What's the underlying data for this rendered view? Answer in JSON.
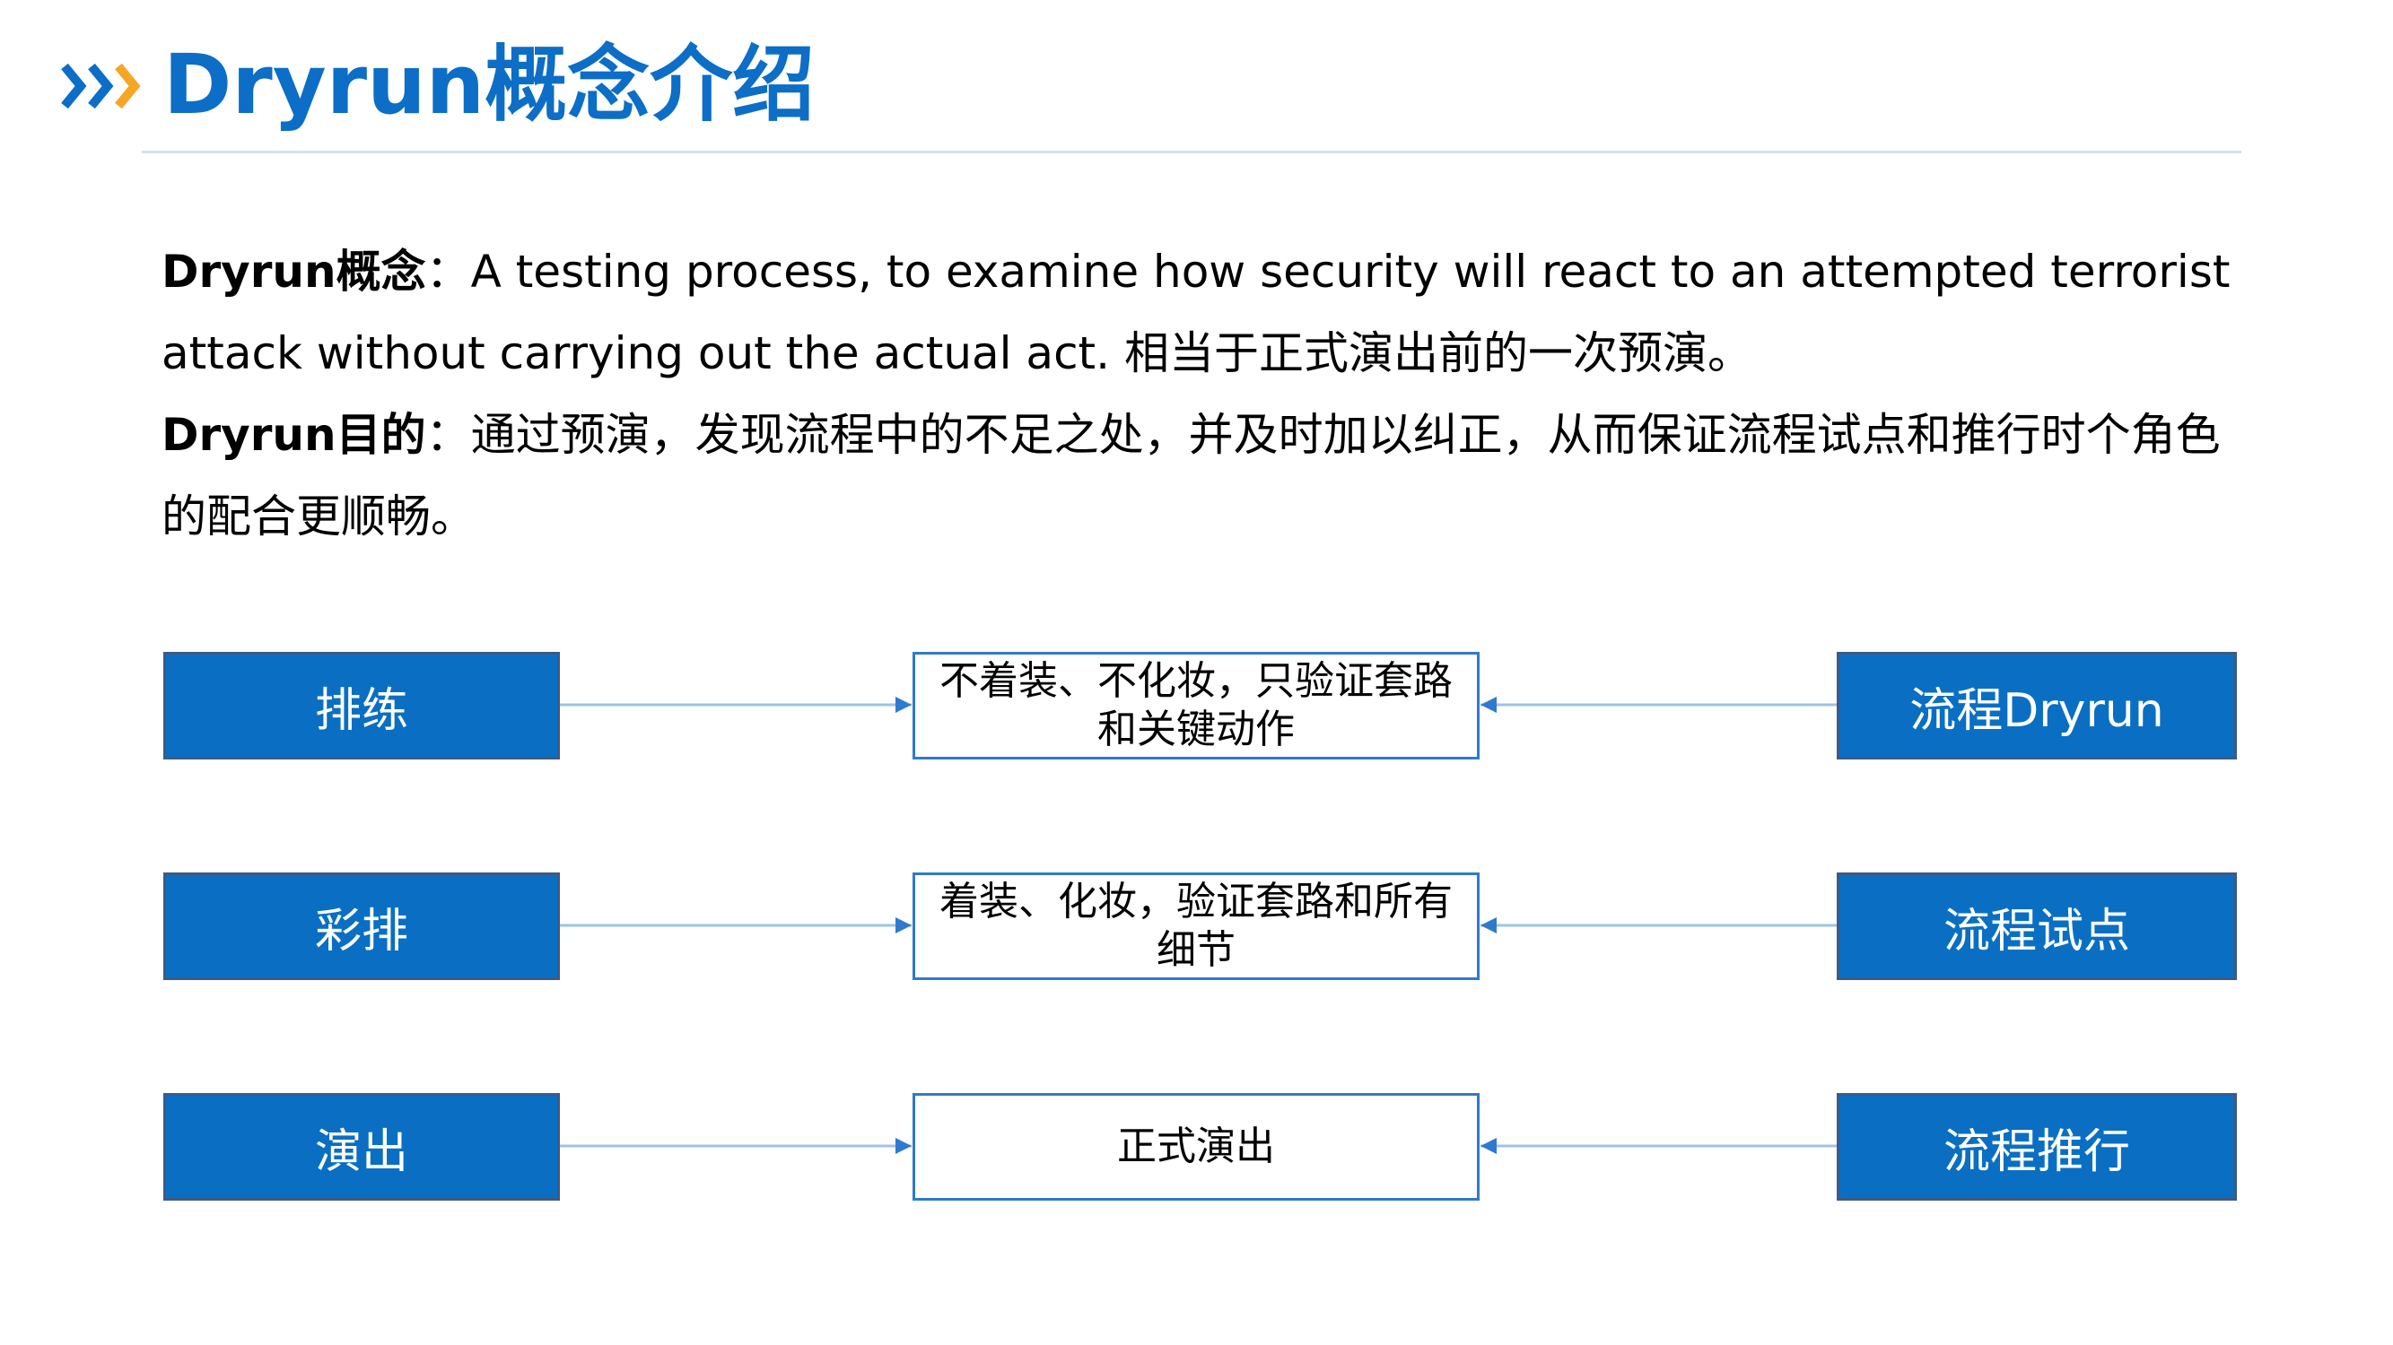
{
  "header": {
    "title": "Dryrun概念介绍",
    "icon": "chevrons-right-icon",
    "accent_color": "#0C6EC6",
    "chevron_colors": [
      "#0C6EC6",
      "#F5A623"
    ]
  },
  "definition": {
    "label": "Dryrun概念",
    "text": "：A testing process, to examine how security will react to an attempted terrorist attack without carrying out the actual act. 相当于正式演出前的一次预演。"
  },
  "purpose": {
    "label": "Dryrun目的",
    "text": "：通过预演，发现流程中的不足之处，并及时加以纠正，从而保证流程试点和推行时个角色的配合更顺畅。"
  },
  "diagram": {
    "rows": [
      {
        "left": "排练",
        "middle_lines": [
          "不着装、不化妆，只验证套路",
          "和关键动作"
        ],
        "right": "流程Dryrun"
      },
      {
        "left": "彩排",
        "middle_lines": [
          "着装、化妆，验证套路和所有",
          "细节"
        ],
        "right": "流程试点"
      },
      {
        "left": "演出",
        "middle_lines": [
          "正式演出"
        ],
        "right": "流程推行"
      }
    ],
    "box_fill_color": "#0A6FC3",
    "connector_color": "#9DC3E6"
  }
}
